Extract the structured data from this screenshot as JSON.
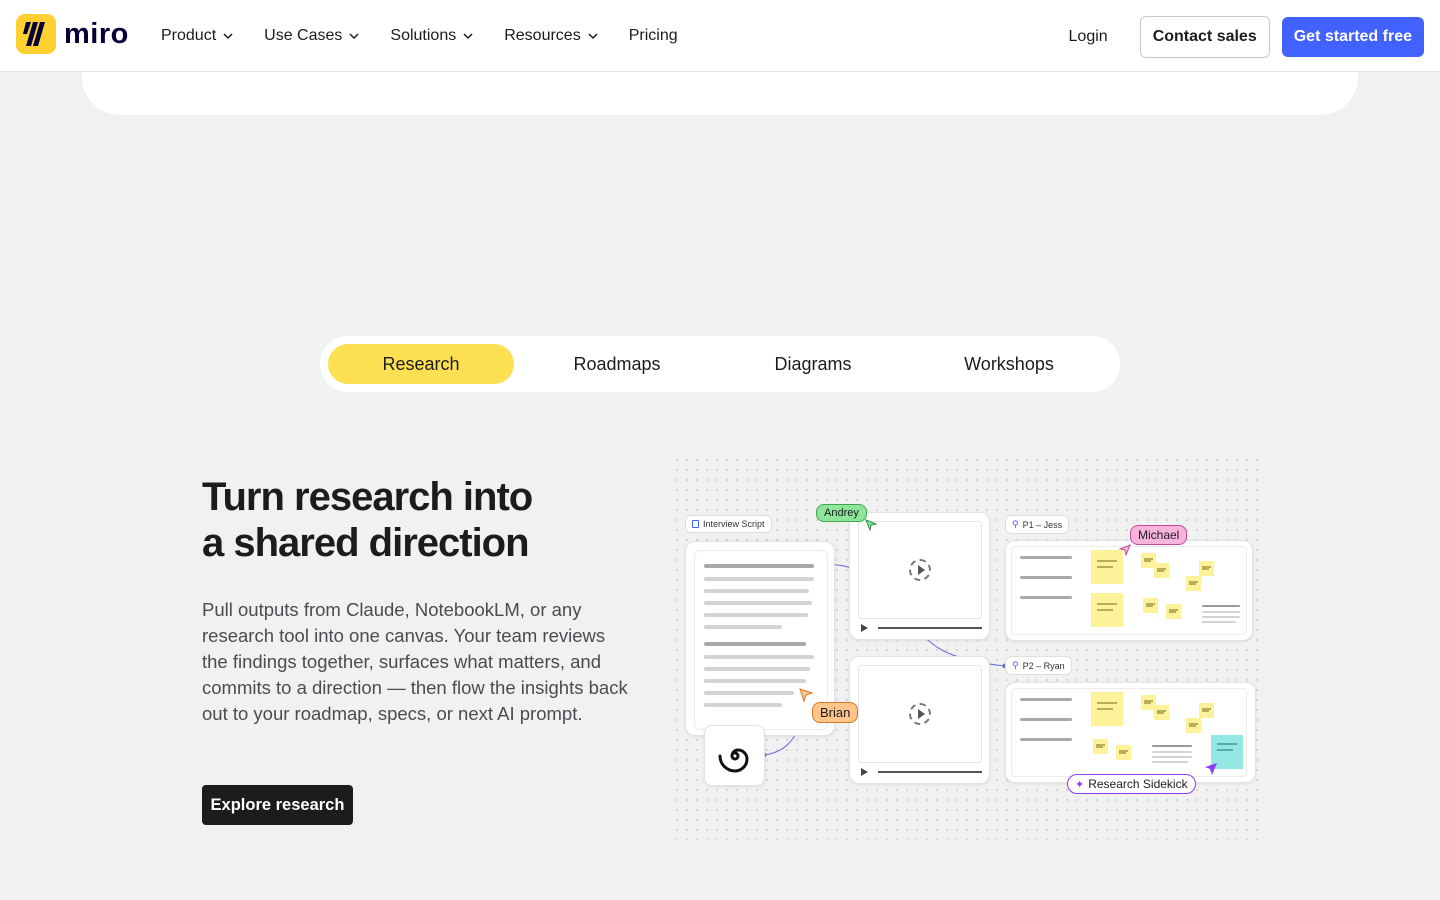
{
  "nav": {
    "logo_text": "miro",
    "menu": [
      {
        "label": "Product"
      },
      {
        "label": "Use Cases"
      },
      {
        "label": "Solutions"
      },
      {
        "label": "Resources"
      },
      {
        "label": "Pricing"
      }
    ],
    "login": "Login",
    "contact_sales": "Contact sales",
    "get_started": "Get started free"
  },
  "tabs": [
    {
      "label": "Research",
      "active": true
    },
    {
      "label": "Roadmaps",
      "active": false
    },
    {
      "label": "Diagrams",
      "active": false
    },
    {
      "label": "Workshops",
      "active": false
    }
  ],
  "hero": {
    "headline_line1": "Turn research into",
    "headline_line2": "a shared direction",
    "body": "Pull outputs from Claude, NotebookLM, or any research tool into one canvas. Your team reviews the findings together, surfaces what matters, and commits to a direction — then flow the insights back out to your roadmap, specs, or next AI prompt.",
    "cta": "Explore research"
  },
  "illustration": {
    "interview_script": "Interview Script",
    "p1_label": "P1 – Jess",
    "p2_label": "P2 – Ryan",
    "users": {
      "andrey": "Andrey",
      "michael": "Michael",
      "brian": "Brian"
    },
    "sidekick": "Research Sidekick"
  },
  "colors": {
    "brand_yellow": "#ffd02f",
    "primary_blue": "#4262ff",
    "tab_active": "#fde051",
    "andrey_tag": "#8ee69a",
    "michael_tag": "#f8b4dd",
    "brian_tag": "#ffc58a",
    "sidekick_accent": "#8c3cff"
  }
}
